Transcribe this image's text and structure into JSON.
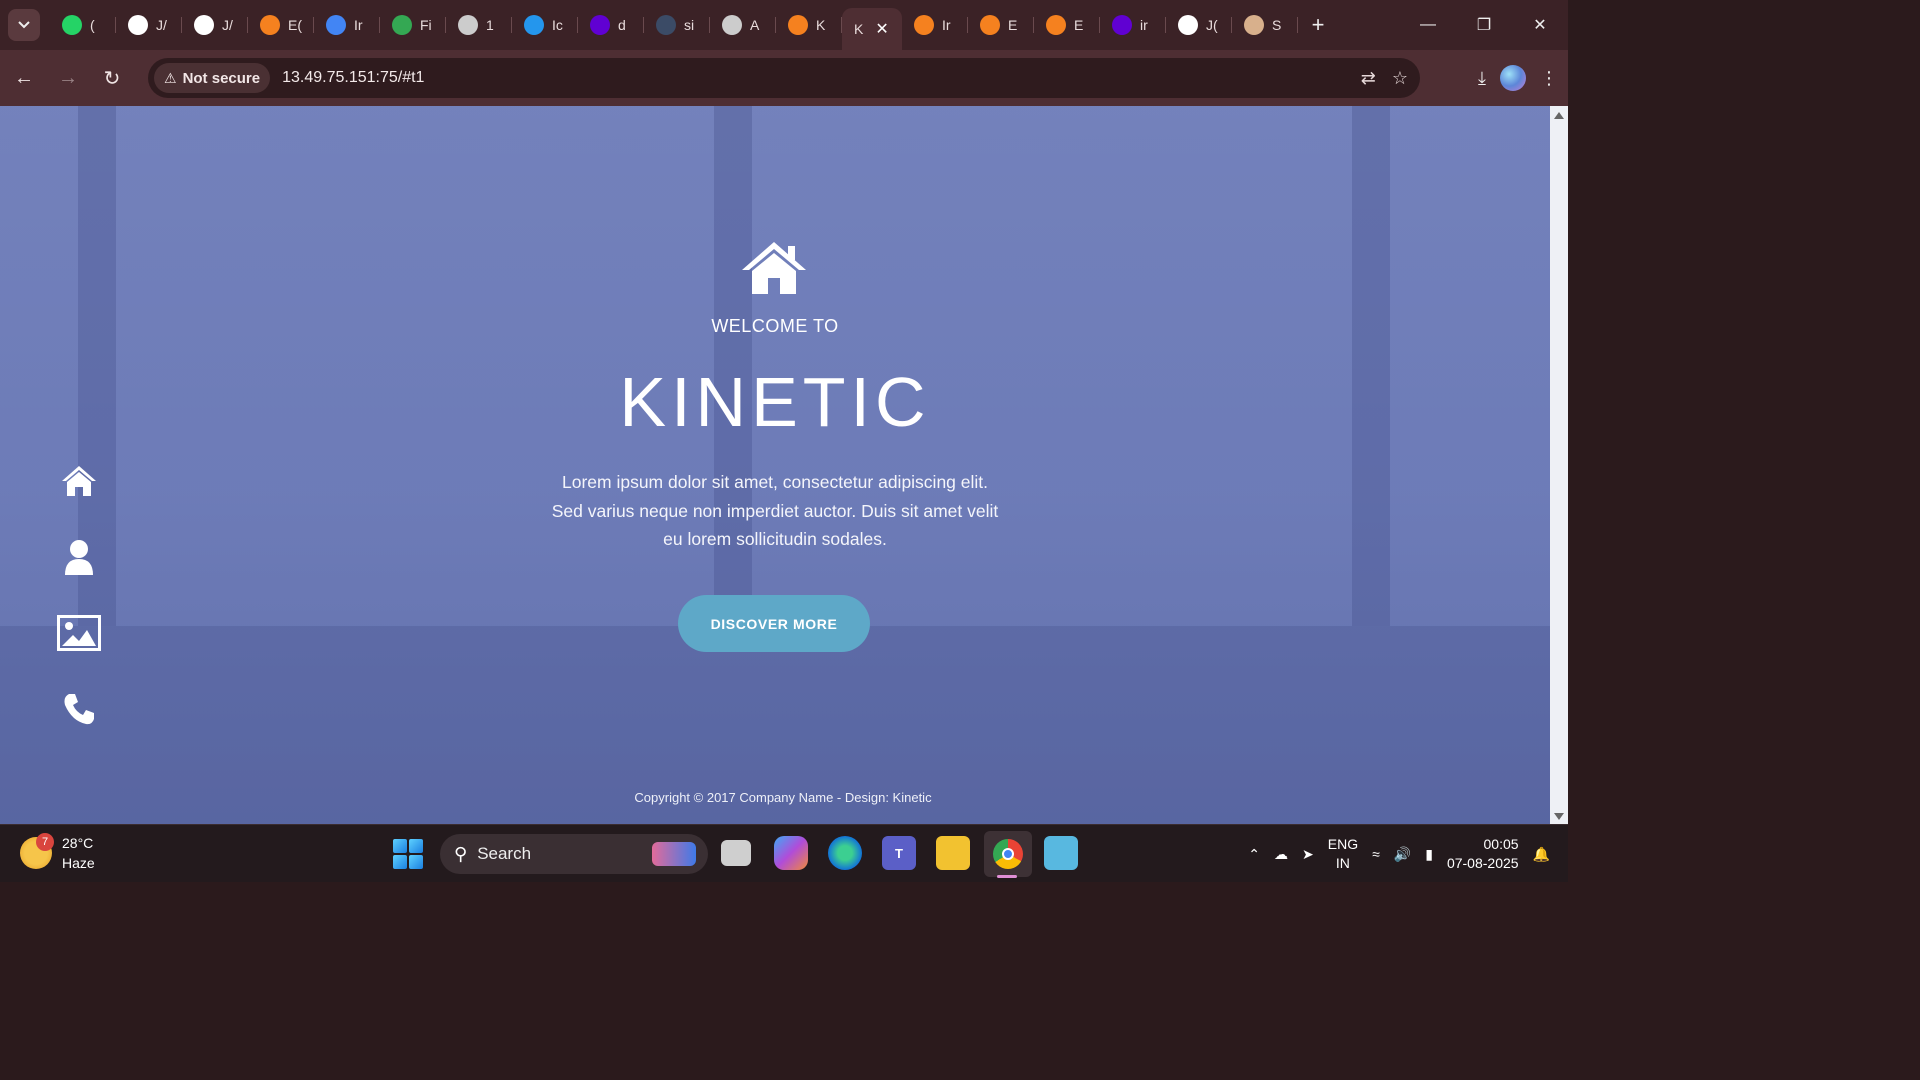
{
  "browser": {
    "tabs": [
      {
        "label": "(",
        "icon": "whatsapp-icon",
        "color": "#25d366"
      },
      {
        "label": "J/",
        "icon": "github-icon",
        "color": "#ffffff"
      },
      {
        "label": "J/",
        "icon": "github-icon",
        "color": "#ffffff"
      },
      {
        "label": "E(",
        "icon": "aws-cube-icon",
        "color": "#f5811f"
      },
      {
        "label": "Ir",
        "icon": "google-cloud-icon",
        "color": "#4285f4"
      },
      {
        "label": "Fi",
        "icon": "link-icon",
        "color": "#34a853"
      },
      {
        "label": "1",
        "icon": "globe-icon",
        "color": "#cccccc"
      },
      {
        "label": "Ic",
        "icon": "docker-icon",
        "color": "#2496ed"
      },
      {
        "label": "d",
        "icon": "yahoo-icon",
        "color": "#6001d2"
      },
      {
        "label": "si",
        "icon": "globe-dark-icon",
        "color": "#3b4b66"
      },
      {
        "label": "A",
        "icon": "globe-icon",
        "color": "#cccccc"
      },
      {
        "label": "K",
        "icon": "t-letter-icon",
        "color": "#f5811f"
      },
      {
        "label": "K",
        "icon": "none",
        "color": "#ffffff",
        "active": true
      },
      {
        "label": "Ir",
        "icon": "aws-orange-icon",
        "color": "#f5811f"
      },
      {
        "label": "E",
        "icon": "aws-cube-icon",
        "color": "#f5811f"
      },
      {
        "label": "E",
        "icon": "aws-cube-icon",
        "color": "#f5811f"
      },
      {
        "label": "ir",
        "icon": "yahoo-icon",
        "color": "#6001d2"
      },
      {
        "label": "J(",
        "icon": "chatgpt-icon",
        "color": "#ffffff"
      },
      {
        "label": "S",
        "icon": "avatar-icon",
        "color": "#d8b08c"
      }
    ],
    "security_chip": "Not secure",
    "url": "13.49.75.151:75/#t1"
  },
  "page": {
    "welcome": "WELCOME TO",
    "brand": "KINETIC",
    "lead_line1": "Lorem ipsum dolor sit amet, consectetur adipiscing elit.",
    "lead_line2": "Sed varius neque non imperdiet auctor. Duis sit amet velit",
    "lead_line3": "eu lorem sollicitudin sodales.",
    "cta": "DISCOVER MORE",
    "footer": "Copyright © 2017 Company Name - Design: Kinetic",
    "overlay_color": "#6070b4",
    "cta_color": "#5ea8c8",
    "side_nav": [
      "home-icon",
      "user-icon",
      "image-icon",
      "phone-icon"
    ]
  },
  "taskbar": {
    "weather_badge": "7",
    "temperature": "28°C",
    "condition": "Haze",
    "search_label": "Search",
    "lang_line1": "ENG",
    "lang_line2": "IN",
    "time": "00:05",
    "date": "07-08-2025"
  }
}
